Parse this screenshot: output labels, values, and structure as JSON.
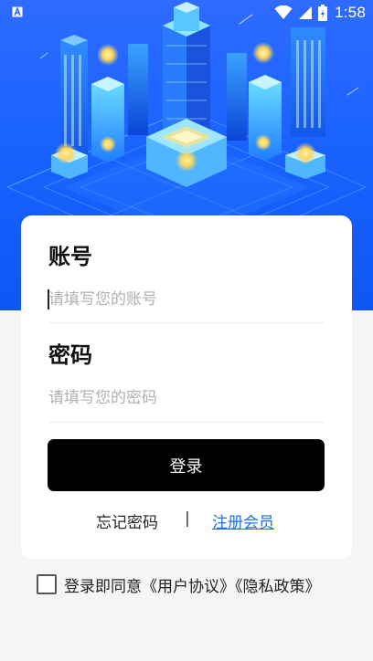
{
  "status_bar": {
    "time": "1:58",
    "app_icon": "a-letter-icon",
    "icons": [
      "wifi-icon",
      "signal-icon",
      "battery-charging-icon"
    ]
  },
  "hero": {
    "illustration": "isometric-smart-city-illustration",
    "colors": {
      "sky": "#1a63ff",
      "building": "#1fb6ff",
      "glow": "#ffd75a"
    }
  },
  "login": {
    "account_label": "账号",
    "account_placeholder": "请填写您的账号",
    "password_label": "密码",
    "password_placeholder": "请填写您的密码",
    "submit_label": "登录",
    "forgot_password": "忘记密码",
    "separator": "|",
    "register": "注册会员"
  },
  "agreement": {
    "checked": false,
    "text": "登录即同意《用户协议》《隐私政策》"
  },
  "colors": {
    "accent": "#1b72e6",
    "button": "#000000",
    "card": "#ffffff",
    "page_background": "#f5f5f5"
  }
}
